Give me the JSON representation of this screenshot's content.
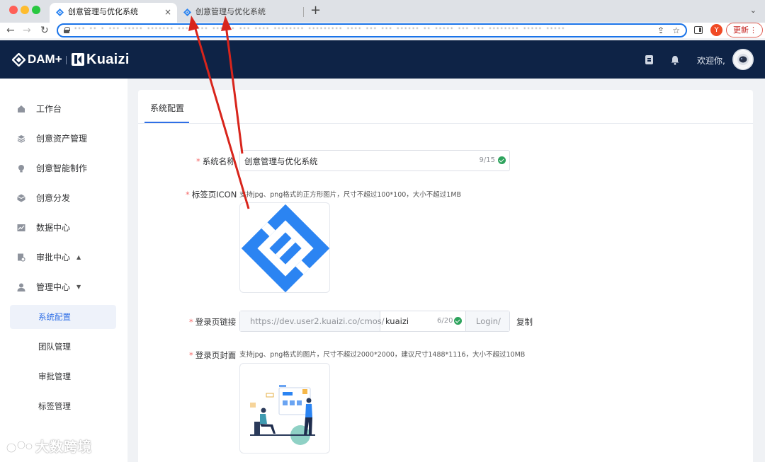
{
  "browser": {
    "tabs": [
      {
        "title": "创意管理与优化系统",
        "close": "×"
      },
      {
        "title": "创意管理与优化系统",
        "close": "×"
      }
    ],
    "new_tab": "+",
    "tab_menu": "⌄",
    "nav": {
      "back": "←",
      "forward": "→",
      "reload": "↻"
    },
    "url": "··· ·· · ··· ····· ······· ···· ··· ······ ··· ···· ········ ········· ···· ··· ··· ······ ·· ····· ··· ··· ········ ····· ·····",
    "share_icon": "⇪",
    "star_icon": "☆",
    "profile_letter": "Y",
    "update_label": "更新",
    "update_menu": "⋮"
  },
  "header": {
    "logo_dam": "DAM+",
    "logo_kuaizi": "Kuaizi",
    "welcome": "欢迎你,"
  },
  "sidebar": {
    "items": [
      {
        "label": "工作台",
        "icon": "home-icon"
      },
      {
        "label": "创意资产管理",
        "icon": "layers-icon"
      },
      {
        "label": "创意智能制作",
        "icon": "bulb-icon"
      },
      {
        "label": "创意分发",
        "icon": "cube-icon"
      },
      {
        "label": "数据中心",
        "icon": "chart-icon"
      },
      {
        "label": "审批中心",
        "icon": "audit-icon",
        "caret": "▲"
      },
      {
        "label": "管理中心",
        "icon": "user-icon",
        "caret": "▼"
      }
    ],
    "sub_items": [
      {
        "label": "系统配置",
        "active": true
      },
      {
        "label": "团队管理",
        "active": false
      },
      {
        "label": "审批管理",
        "active": false
      },
      {
        "label": "标签管理",
        "active": false
      }
    ]
  },
  "watermark": "大数跨境",
  "card": {
    "tab_label": "系统配置",
    "form": {
      "required_mark": "*",
      "system_name": {
        "label": "系统名称",
        "value": "创意管理与优化系统",
        "counter": "9/15"
      },
      "tab_icon": {
        "label": "标签页ICON",
        "hint": "支持jpg、png格式的正方形图片，尺寸不超过100*100，大小不超过1MB"
      },
      "login_link": {
        "label": "登录页链接",
        "prefix": "https://dev.user2.kuaizi.co/cmos/",
        "value": "kuaizi",
        "counter": "6/20",
        "suffix": "Login/",
        "copy_label": "复制"
      },
      "login_cover": {
        "label": "登录页封面",
        "hint": "支持jpg、png格式的图片，尺寸不超过2000*2000，建议尺寸1488*1116，大小不超过10MB"
      }
    }
  },
  "colors": {
    "header_bg": "#0e2346",
    "accent": "#2f6fe6",
    "icon_blue": "#2b84f2",
    "annotation_red": "#d8251c",
    "required": "#f56c6c",
    "success": "#2ea35d"
  }
}
